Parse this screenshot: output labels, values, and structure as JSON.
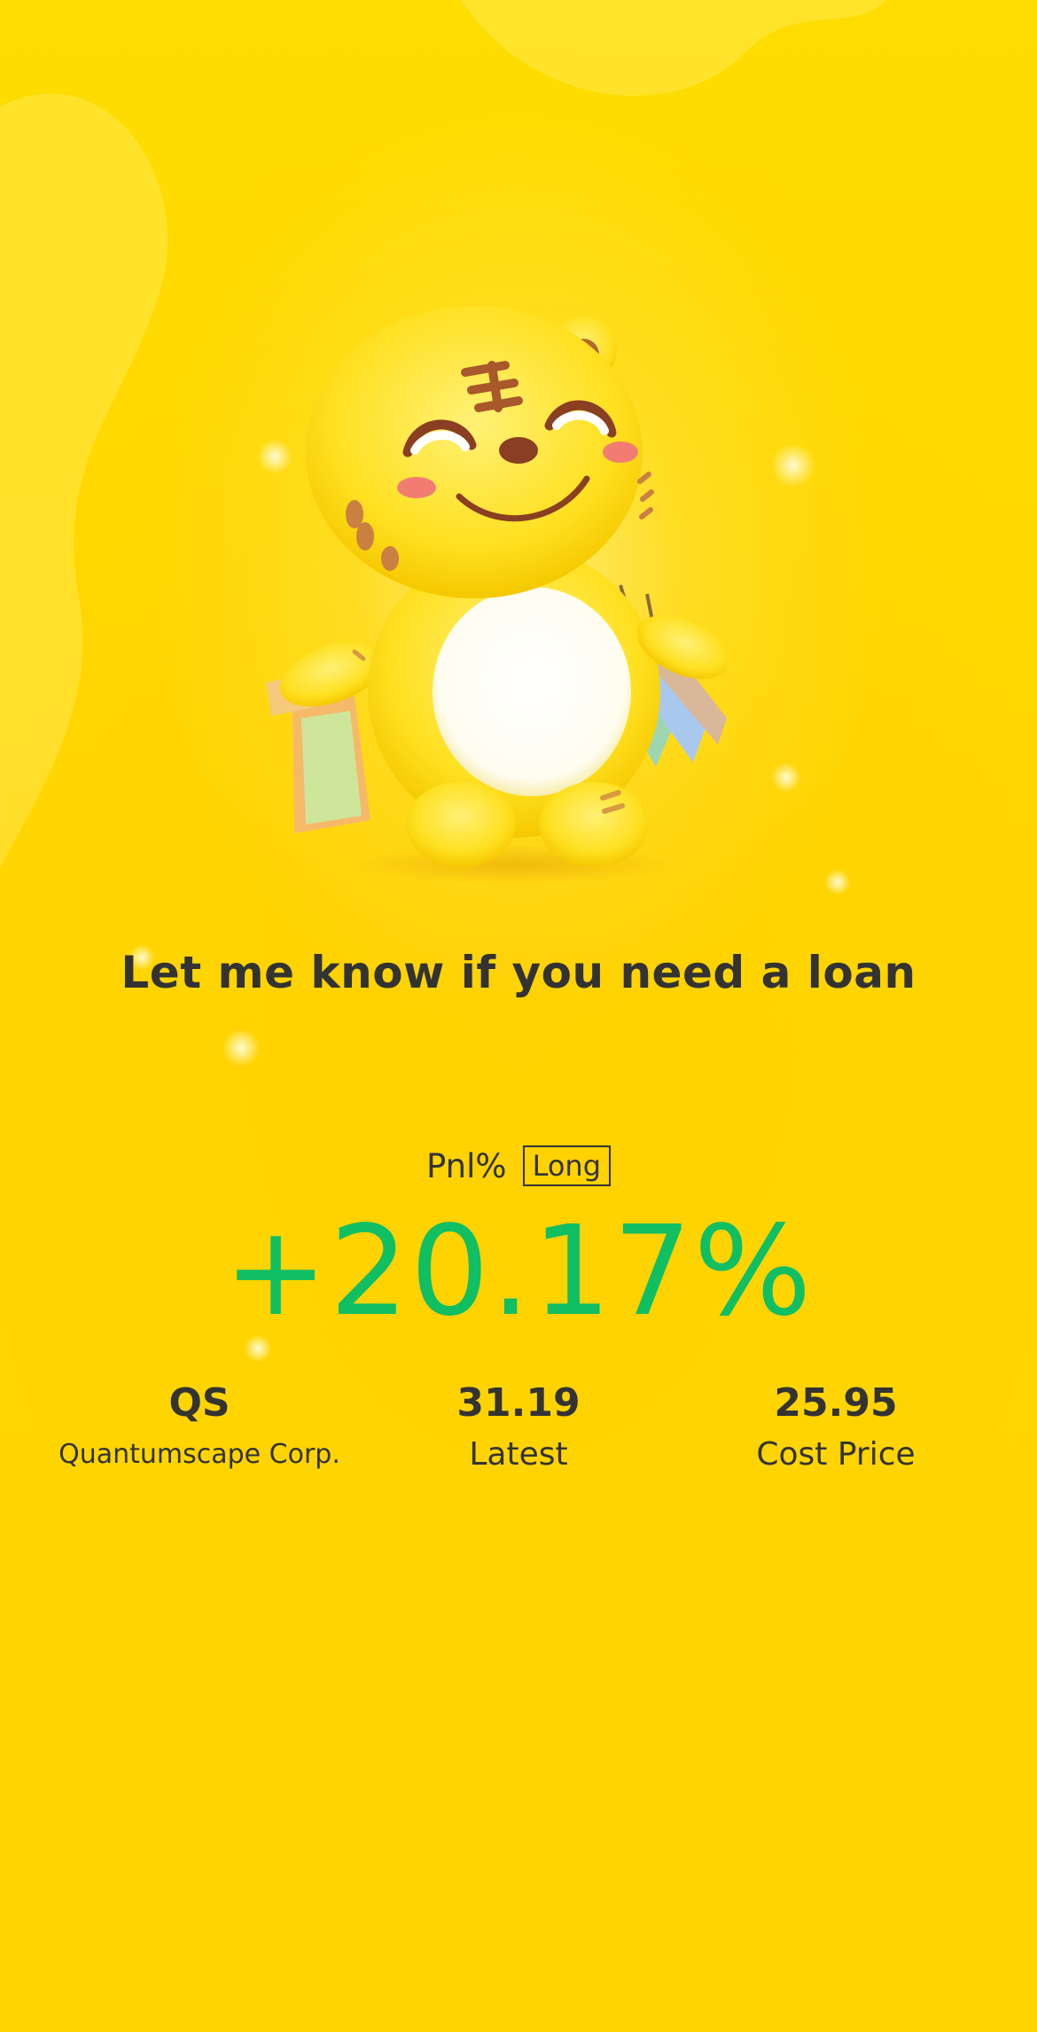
{
  "tagline": "Let me know if you need a loan",
  "pnl": {
    "label": "Pnl%",
    "badge": "Long",
    "value": "+20.17%",
    "value_color": "#10BE64"
  },
  "stats": [
    {
      "value": "QS",
      "label": "Quantumscape Corp."
    },
    {
      "value": "31.19",
      "label": "Latest"
    },
    {
      "value": "25.95",
      "label": "Cost Price"
    }
  ],
  "colors": {
    "background": "#FFD600",
    "text": "#333333"
  },
  "icons": {
    "mascot": "tiger-mascot-with-shopping-bags-icon"
  }
}
